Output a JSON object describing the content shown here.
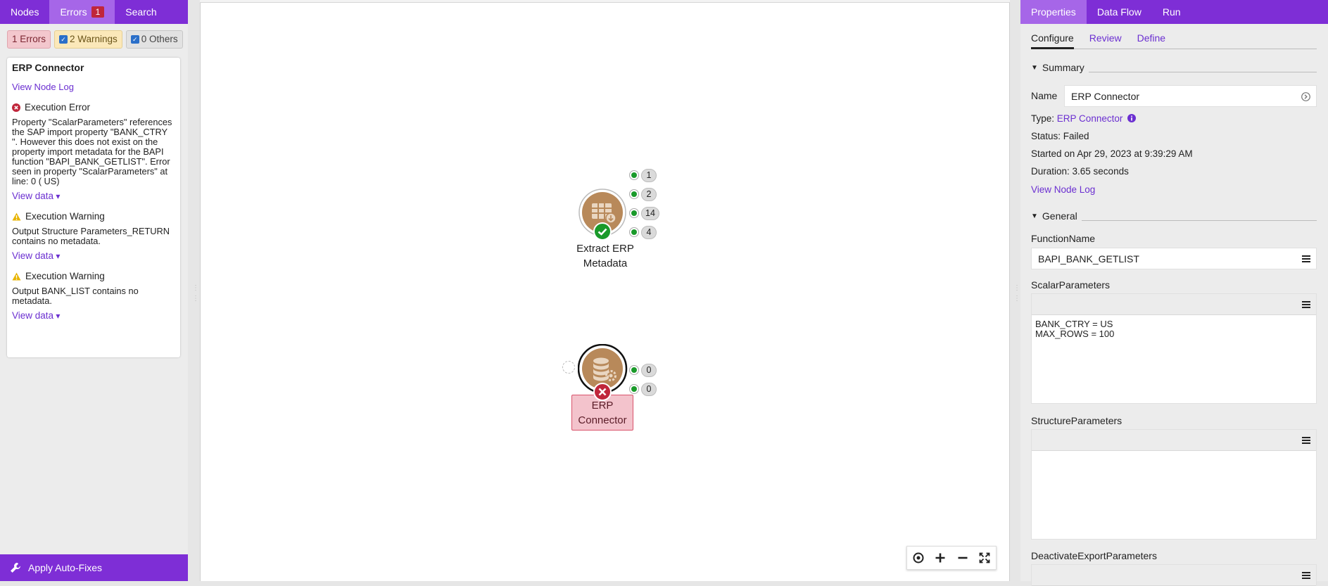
{
  "left_panel": {
    "tabs": [
      {
        "label": "Nodes"
      },
      {
        "label": "Errors",
        "badge": "1"
      },
      {
        "label": "Search"
      }
    ],
    "filters": {
      "errors": "1 Errors",
      "warnings": "2 Warnings",
      "others": "0 Others"
    },
    "card": {
      "title": "ERP Connector",
      "view_log": "View Node Log",
      "messages": [
        {
          "type": "error",
          "heading": "Execution Error",
          "body": "Property \"ScalarParameters\" references the SAP import property \"BANK_CTRY \". However this does not exist on the property import metadata for the BAPI function \"BAPI_BANK_GETLIST\". Error seen in property \"ScalarParameters\" at line: 0 ( US)",
          "view_data": "View data"
        },
        {
          "type": "warning",
          "heading": "Execution Warning",
          "body": "Output Structure Parameters_RETURN contains no metadata.",
          "view_data": "View data"
        },
        {
          "type": "warning",
          "heading": "Execution Warning",
          "body": "Output BANK_LIST contains no metadata.",
          "view_data": "View data"
        }
      ]
    },
    "autofix_label": "Apply Auto-Fixes"
  },
  "canvas": {
    "nodes": [
      {
        "label_line1": "Extract ERP",
        "label_line2": "Metadata",
        "status": "success",
        "ports": [
          "1",
          "2",
          "14",
          "4"
        ]
      },
      {
        "label_line1": "ERP",
        "label_line2": "Connector",
        "status": "error",
        "ports": [
          "0",
          "0"
        ]
      }
    ]
  },
  "right_panel": {
    "tabs": [
      {
        "label": "Properties"
      },
      {
        "label": "Data Flow"
      },
      {
        "label": "Run"
      }
    ],
    "subtabs": [
      {
        "label": "Configure"
      },
      {
        "label": "Review"
      },
      {
        "label": "Define"
      }
    ],
    "summary": {
      "section_label": "Summary",
      "name_label": "Name",
      "name_value": "ERP Connector",
      "type_label": "Type:",
      "type_value": "ERP Connector",
      "status": "Status: Failed",
      "started": "Started on Apr 29, 2023 at 9:39:29 AM",
      "duration": "Duration: 3.65 seconds",
      "view_log": "View Node Log"
    },
    "general": {
      "section_label": "General",
      "function_name_label": "FunctionName",
      "function_name_value": "BAPI_BANK_GETLIST",
      "scalar_label": "ScalarParameters",
      "scalar_value": "BANK_CTRY = US\nMAX_ROWS = 100",
      "structure_label": "StructureParameters",
      "structure_value": "",
      "deactivate_label": "DeactivateExportParameters"
    }
  },
  "colors": {
    "accent": "#7e2ed6",
    "error": "#c0263b",
    "success": "#1a9a2a",
    "node_brown": "#b8895a"
  }
}
